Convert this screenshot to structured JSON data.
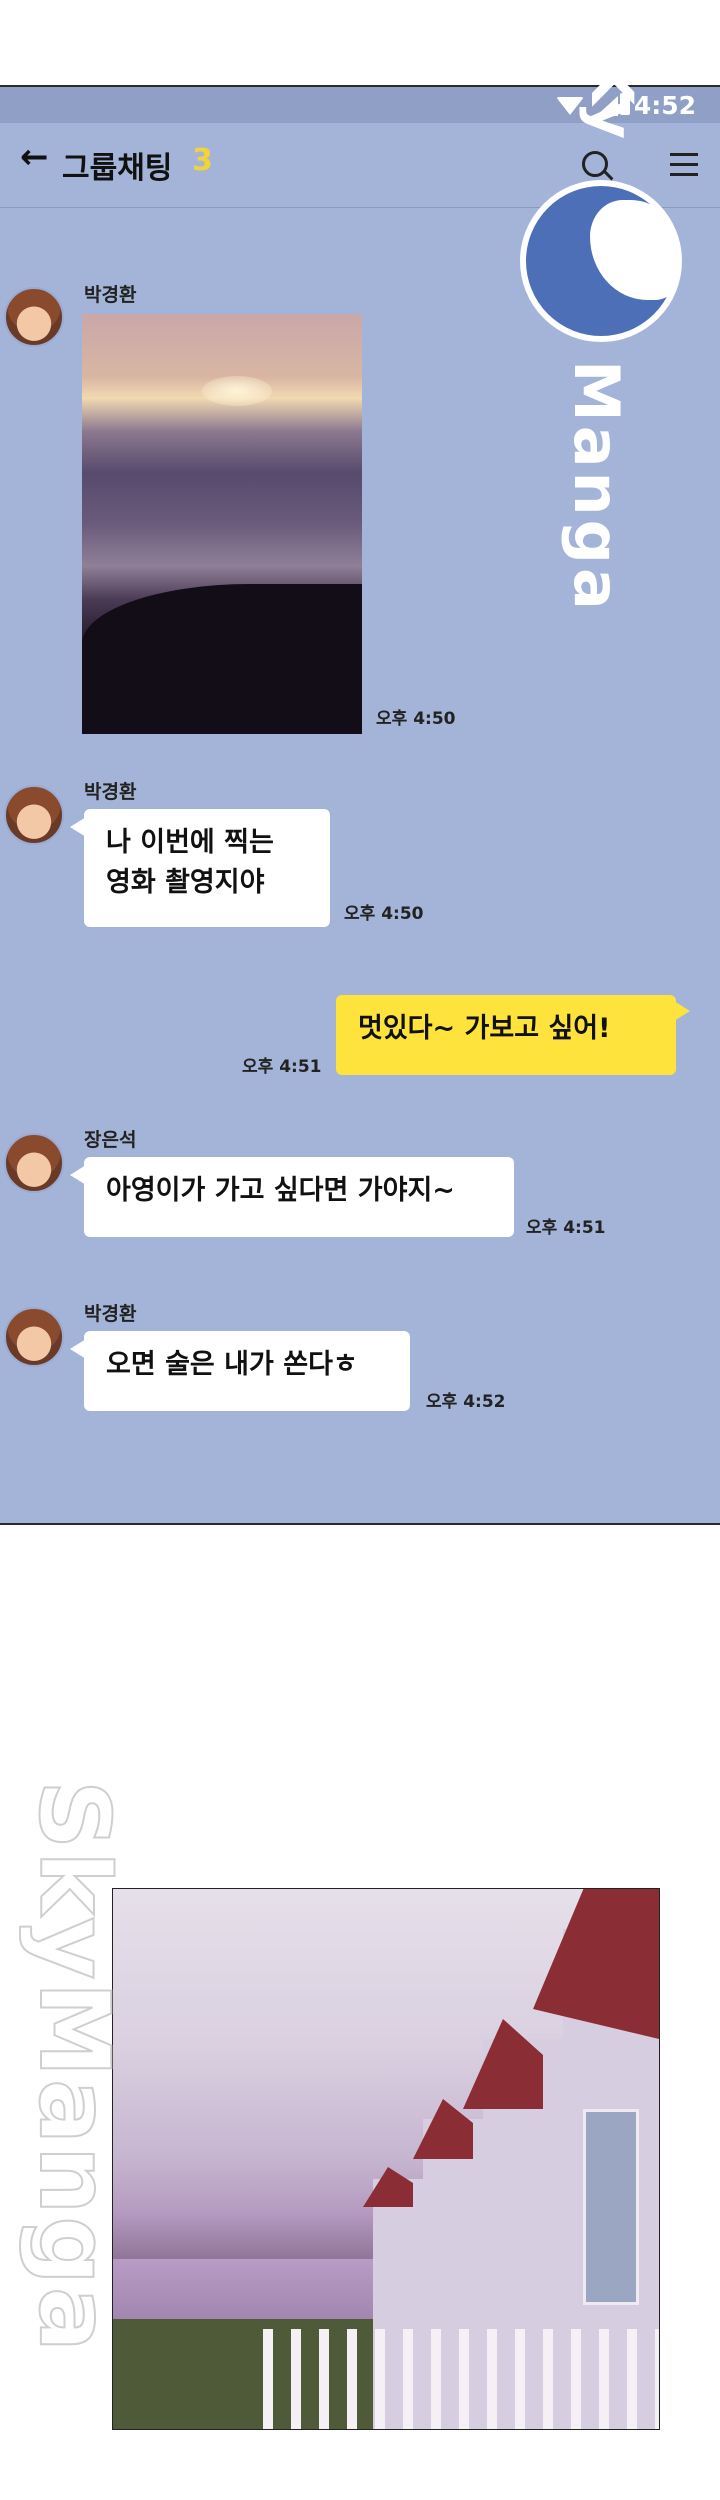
{
  "status": {
    "time": "4:52"
  },
  "header": {
    "title": "그룹채팅",
    "member_count": "3"
  },
  "messages": [
    {
      "sender": "박경환",
      "type": "image",
      "time": "오후 4:50"
    },
    {
      "sender": "박경환",
      "line1": "나 이번에 찍는",
      "line2": "영화 촬영지야",
      "time": "오후 4:50"
    },
    {
      "sender": "me",
      "text": "멋있다~ 가보고 싶어!",
      "time": "오후 4:51"
    },
    {
      "sender": "장은석",
      "text": "아영이가 가고 싶다면 가야지~",
      "time": "오후 4:51"
    },
    {
      "sender": "박경환",
      "text": "오면 술은 내가 쏜다ㅎ",
      "time": "오후 4:52"
    }
  ],
  "watermark": {
    "top": "Ky",
    "text": "Manga",
    "brand": "SkyManga"
  },
  "colors": {
    "chat_bg": "#a4b4d8",
    "my_bubble": "#fde33c",
    "their_bubble": "#ffffff",
    "count": "#f2d43a"
  }
}
